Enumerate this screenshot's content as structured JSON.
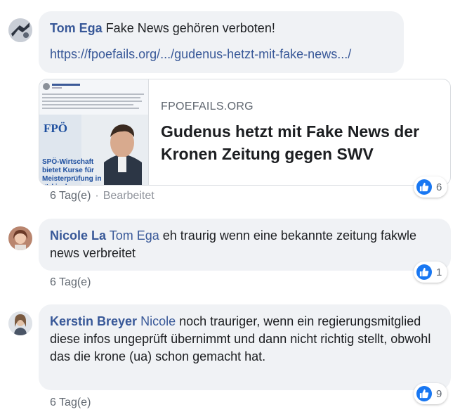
{
  "comments": [
    {
      "author": "Tom Ega",
      "text": "Fake News gehören verboten!",
      "link": "https://fpoefails.org/.../gudenus-hetzt-mit-fake-news.../",
      "time": "6 Tag(e)",
      "edited": "Bearbeitet",
      "separator": "·",
      "likes": "6",
      "preview": {
        "domain": "FPOEFAILS.ORG",
        "title": "Gudenus hetzt mit Fake News der Kronen Zeitung gegen SWV",
        "thumb_logo": "FPÖ",
        "thumb_headline": "SPÖ-Wirtschaft bietet Kurse für Meisterprüfung in türkischer"
      }
    },
    {
      "author": "Nicole La",
      "mention": "Tom Ega",
      "text": "eh traurig wenn eine bekannte zeitung fakwle news verbreitet",
      "time": "6 Tag(e)",
      "likes": "1"
    },
    {
      "author": "Kerstin Breyer",
      "mention": "Nicole",
      "text": "noch trauriger, wenn ein regierungsmitglied diese infos ungeprüft übernimmt und dann nicht richtig stellt, obwohl das die krone (ua) schon gemacht hat.",
      "time": "6 Tag(e)",
      "likes": "9"
    }
  ],
  "colors": {
    "author": "#385898",
    "bubble": "#f0f2f5",
    "like_blue": "#1877f2",
    "meta": "#606770"
  },
  "icons": [
    "avatar",
    "like-icon"
  ]
}
